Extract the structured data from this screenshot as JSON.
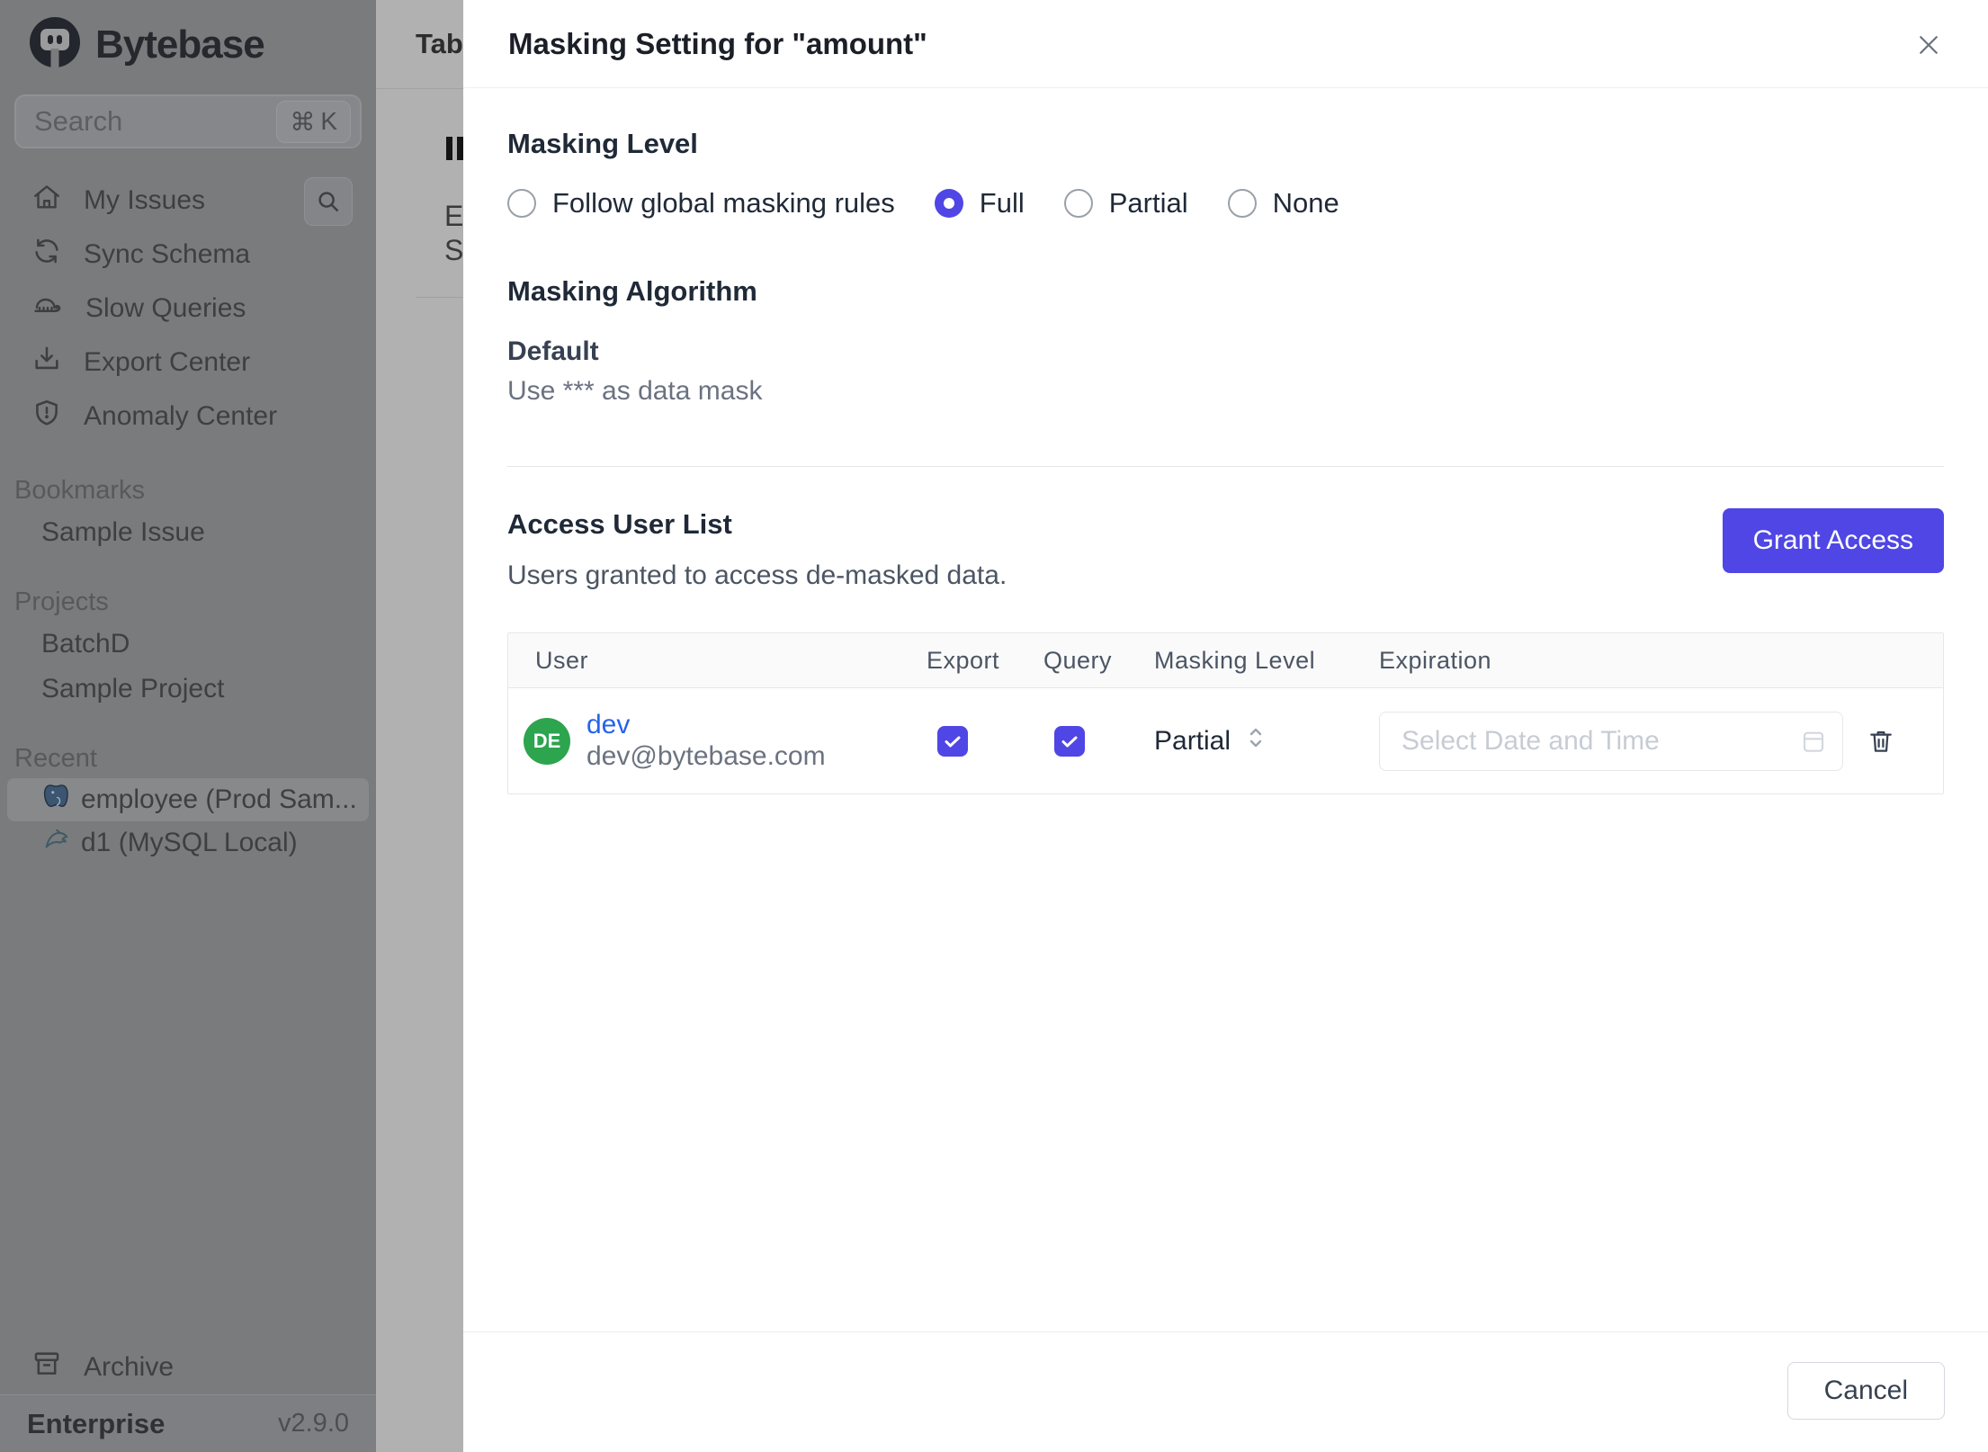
{
  "colors": {
    "accent": "#4f46e5",
    "avatar_green": "#2da44e",
    "link_blue": "#2563eb"
  },
  "sidebar": {
    "brand": "Bytebase",
    "search": {
      "placeholder": "Search",
      "shortcut_key": "K",
      "shortcut_modifier": "⌘"
    },
    "nav": [
      {
        "icon": "home-icon",
        "label": "My Issues"
      },
      {
        "icon": "sync-icon",
        "label": "Sync Schema"
      },
      {
        "icon": "turtle-icon",
        "label": "Slow Queries"
      },
      {
        "icon": "download-icon",
        "label": "Export Center"
      },
      {
        "icon": "shield-icon",
        "label": "Anomaly Center"
      }
    ],
    "sections": {
      "bookmarks": {
        "title": "Bookmarks",
        "items": [
          {
            "label": "Sample Issue"
          }
        ]
      },
      "projects": {
        "title": "Projects",
        "items": [
          {
            "label": "BatchD"
          },
          {
            "label": "Sample Project"
          }
        ]
      },
      "recent": {
        "title": "Recent",
        "items": [
          {
            "icon": "postgres-icon",
            "label": "employee (Prod Sam...",
            "selected": true
          },
          {
            "icon": "mysql-icon",
            "label": "d1 (MySQL Local)",
            "selected": false
          }
        ]
      }
    },
    "archive_label": "Archive",
    "footer": {
      "plan": "Enterprise",
      "version": "v2.9.0"
    }
  },
  "background_page": {
    "header_title": "Tab",
    "visible_letters": [
      "E",
      "S"
    ]
  },
  "modal": {
    "title": "Masking Setting for \"amount\"",
    "masking_level": {
      "heading": "Masking Level",
      "options": [
        {
          "label": "Follow global masking rules",
          "selected": false
        },
        {
          "label": "Full",
          "selected": true
        },
        {
          "label": "Partial",
          "selected": false
        },
        {
          "label": "None",
          "selected": false
        }
      ]
    },
    "masking_algorithm": {
      "heading": "Masking Algorithm",
      "name": "Default",
      "description": "Use *** as data mask"
    },
    "access_user_list": {
      "heading": "Access User List",
      "subtitle": "Users granted to access de-masked data.",
      "grant_button": "Grant Access",
      "table": {
        "columns": [
          "User",
          "Export",
          "Query",
          "Masking Level",
          "Expiration"
        ],
        "rows": [
          {
            "avatar_initials": "DE",
            "name": "dev",
            "email": "dev@bytebase.com",
            "export_checked": true,
            "query_checked": true,
            "masking_level": "Partial",
            "expiration_placeholder": "Select Date and Time"
          }
        ]
      }
    },
    "footer": {
      "cancel_label": "Cancel"
    }
  }
}
